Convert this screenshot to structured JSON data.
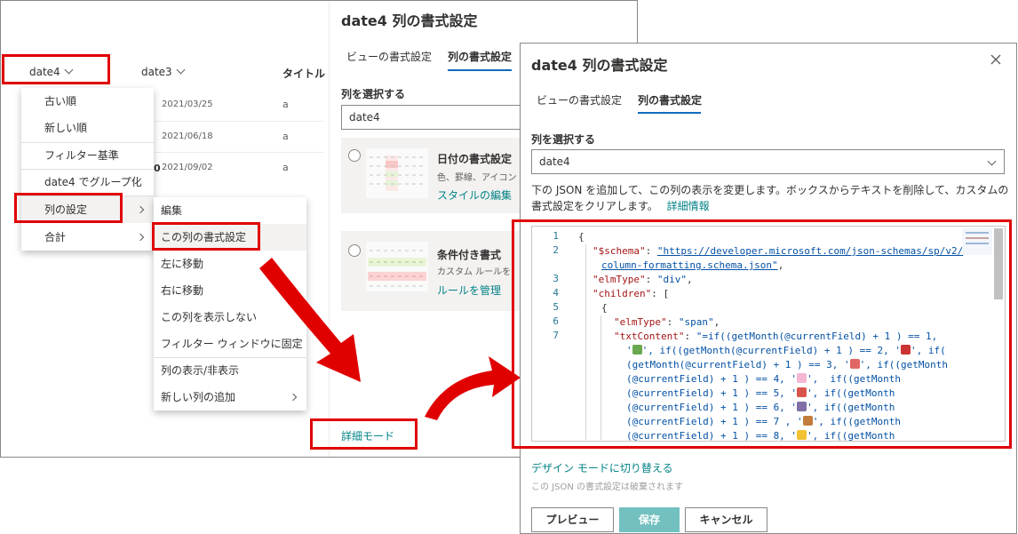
{
  "list": {
    "columns": [
      "date4",
      "date3",
      "タイトル"
    ],
    "rows": [
      {
        "date3": "2021/03/25",
        "title": "a"
      },
      {
        "date3": "2021/06/18",
        "title": "a"
      },
      {
        "date3": "2021/09/02",
        "title": "a"
      }
    ],
    "partial_digit": "0"
  },
  "dropdown_menu": {
    "items": [
      "古い順",
      "新しい順",
      "フィルター基準",
      "date4 でグループ化",
      "列の設定",
      "合計"
    ]
  },
  "submenu": {
    "items": [
      "編集",
      "この列の書式設定",
      "左に移動",
      "右に移動",
      "この列を表示しない",
      "フィルター ウィンドウに固定",
      "列の表示/非表示",
      "新しい列の追加"
    ]
  },
  "back_panel": {
    "title": "date4 列の書式設定",
    "tabs": [
      "ビューの書式設定",
      "列の書式設定"
    ],
    "select_label": "列を選択する",
    "select_value": "date4",
    "card1": {
      "title": "日付の書式設定",
      "desc": "色、罫線、アイコン",
      "link": "スタイルの編集"
    },
    "card2": {
      "title": "条件付き書式",
      "desc": "カスタム ルールを",
      "link": "ルールを管理"
    },
    "advanced_link": "詳細モード"
  },
  "front_panel": {
    "title": "date4 列の書式設定",
    "tabs": [
      "ビューの書式設定",
      "列の書式設定"
    ],
    "select_label": "列を選択する",
    "select_value": "date4",
    "help_text_1": "下の JSON を追加して、この列の表示を変更します。ボックスからテキストを削除して、カスタムの",
    "help_text_2": "書式設定をクリアします。",
    "help_link": "詳細情報",
    "design_mode_link": "デザイン モードに切り替える",
    "discard_note": "この JSON の書式設定は破棄されます",
    "buttons": {
      "preview": "プレビュー",
      "save": "保存",
      "cancel": "キャンセル"
    }
  },
  "code": {
    "line_numbers": [
      "1",
      "2",
      "",
      "3",
      "4",
      "5",
      "6",
      "7",
      "",
      "",
      "",
      "",
      "",
      "",
      ""
    ],
    "l1": "{",
    "l2k": "\"$schema\"",
    "l2u": "\"https://developer.microsoft.com/json-schemas/sp/v2/",
    "l2b": "column-formatting.schema.json\"",
    "l3k": "\"elmType\"",
    "l3v": "\"div\"",
    "l4k": "\"children\"",
    "l5": "{",
    "l6k": "\"elmType\"",
    "l6v": "\"span\"",
    "l7k": "\"txtContent\"",
    "l7a": "\"=if((getMonth(@currentField) + 1 ) == 1,",
    "l7b": "', if((getMonth(@currentField) + 1 ) == 2, '",
    "l7c": "', if(",
    "l7d": "(getMonth(@currentField) + 1 ) == 3, '",
    "l7e": "', if((getMonth",
    "l7f": "(@currentField) + 1 ) == 4, '",
    "l7g": "',  if((getMonth",
    "l7h": "(@currentField) + 1 ) == 5, '",
    "l7i": "', if((getMonth",
    "l7j": "(@currentField) + 1 ) == 6, '",
    "l7k2": "', if((getMonth",
    "l7l": "(@currentField) + 1 ) == 7 , '",
    "l7m": "', if((getMonth",
    "l7n": "(@currentField) + 1 ) == 8, '",
    "l7o": "', if((getMonth"
  },
  "colors": {
    "highlight": "#e00000",
    "accent": "#0f6cbd",
    "link": "#038387",
    "save": "#73c0c0"
  },
  "icons": [
    "chevron-down-icon",
    "chevron-right-icon",
    "close-icon",
    "red-arrow"
  ]
}
